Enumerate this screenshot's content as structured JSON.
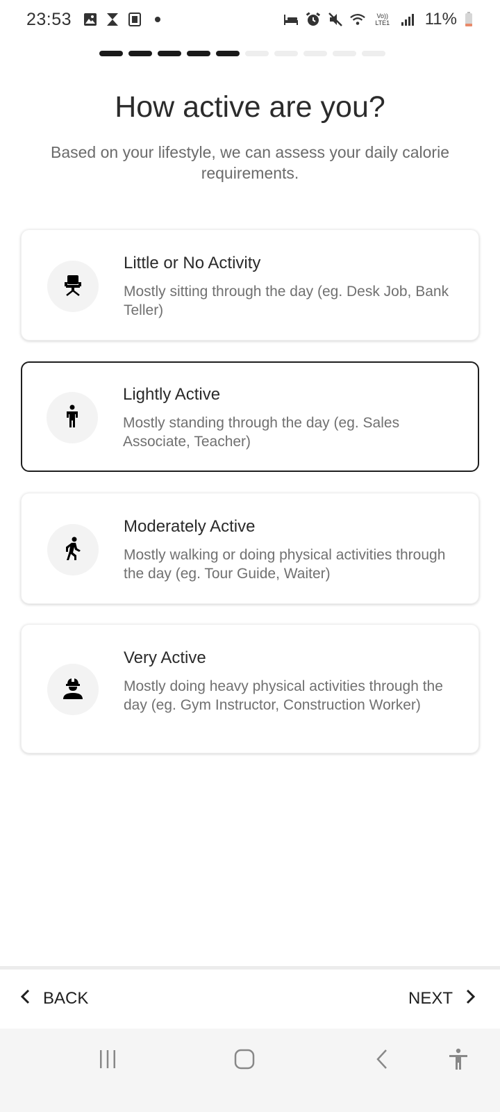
{
  "status_bar": {
    "time": "23:53",
    "battery": "11%",
    "network": "Vo)) LTE1"
  },
  "progress": {
    "total_steps": 10,
    "completed_steps": 5
  },
  "header": {
    "title": "How active are you?",
    "subtitle": "Based on your lifestyle, we can assess your daily calorie requirements."
  },
  "options": [
    {
      "title": "Little or No Activity",
      "description": "Mostly sitting through the day (eg. Desk Job, Bank Teller)",
      "icon": "office-chair-icon",
      "selected": false
    },
    {
      "title": "Lightly Active",
      "description": "Mostly standing through the day (eg. Sales Associate, Teacher)",
      "icon": "standing-person-icon",
      "selected": true
    },
    {
      "title": "Moderately Active",
      "description": "Mostly walking or doing physical activities through the day (eg. Tour Guide, Waiter)",
      "icon": "walking-person-icon",
      "selected": false
    },
    {
      "title": "Very Active",
      "description": "Mostly doing heavy physical activities through the day (eg. Gym Instructor, Construction Worker)",
      "icon": "construction-worker-icon",
      "selected": false
    }
  ],
  "footer": {
    "back_label": "BACK",
    "next_label": "NEXT"
  },
  "colors": {
    "selected_border": "#1e1e1e",
    "progress_done": "#1a1a1a",
    "progress_pending": "#eeeeee",
    "icon_circle": "#f3f3f3"
  }
}
